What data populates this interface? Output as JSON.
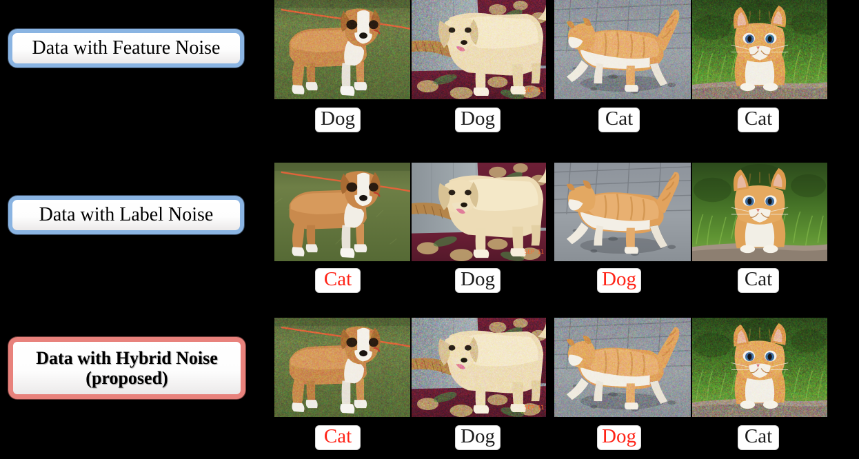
{
  "figure": {
    "background_color": "#000000",
    "accent_blue": "#8ab4e2",
    "accent_red": "#e8827c",
    "noisy_label_color": "#ff2418",
    "clean_label_color": "#1b1b1b"
  },
  "rows": [
    {
      "id": "feature-noise",
      "title": "Data with Feature Noise",
      "title_style": "blue",
      "images": [
        {
          "subject": "boxer-puppy-on-grass",
          "noisy_image": true
        },
        {
          "subject": "golden-retriever-puppy-on-chair",
          "noisy_image": true
        },
        {
          "subject": "orange-kitten-walking-on-pavement",
          "noisy_image": true
        },
        {
          "subject": "orange-kitten-sitting-on-grass",
          "noisy_image": true
        }
      ],
      "labels": [
        {
          "text": "Dog",
          "noisy_label": false
        },
        {
          "text": "Dog",
          "noisy_label": false
        },
        {
          "text": "Cat",
          "noisy_label": false
        },
        {
          "text": "Cat",
          "noisy_label": false
        }
      ]
    },
    {
      "id": "label-noise",
      "title": "Data with Label Noise",
      "title_style": "blue",
      "images": [
        {
          "subject": "boxer-puppy-on-grass",
          "noisy_image": false
        },
        {
          "subject": "golden-retriever-puppy-on-chair",
          "noisy_image": false
        },
        {
          "subject": "orange-kitten-walking-on-pavement",
          "noisy_image": false
        },
        {
          "subject": "orange-kitten-sitting-on-grass",
          "noisy_image": false
        }
      ],
      "labels": [
        {
          "text": "Cat",
          "noisy_label": true
        },
        {
          "text": "Dog",
          "noisy_label": false
        },
        {
          "text": "Dog",
          "noisy_label": true
        },
        {
          "text": "Cat",
          "noisy_label": false
        }
      ]
    },
    {
      "id": "hybrid-noise",
      "title": "Data with Hybrid Noise",
      "title_line2": "(proposed)",
      "title_style": "red",
      "images": [
        {
          "subject": "boxer-puppy-on-grass",
          "noisy_image": true
        },
        {
          "subject": "golden-retriever-puppy-on-chair",
          "noisy_image": true
        },
        {
          "subject": "orange-kitten-walking-on-pavement",
          "noisy_image": true
        },
        {
          "subject": "orange-kitten-sitting-on-grass",
          "noisy_image": true
        }
      ],
      "labels": [
        {
          "text": "Cat",
          "noisy_label": true
        },
        {
          "text": "Dog",
          "noisy_label": false
        },
        {
          "text": "Dog",
          "noisy_label": true
        },
        {
          "text": "Cat",
          "noisy_label": false
        }
      ]
    }
  ]
}
